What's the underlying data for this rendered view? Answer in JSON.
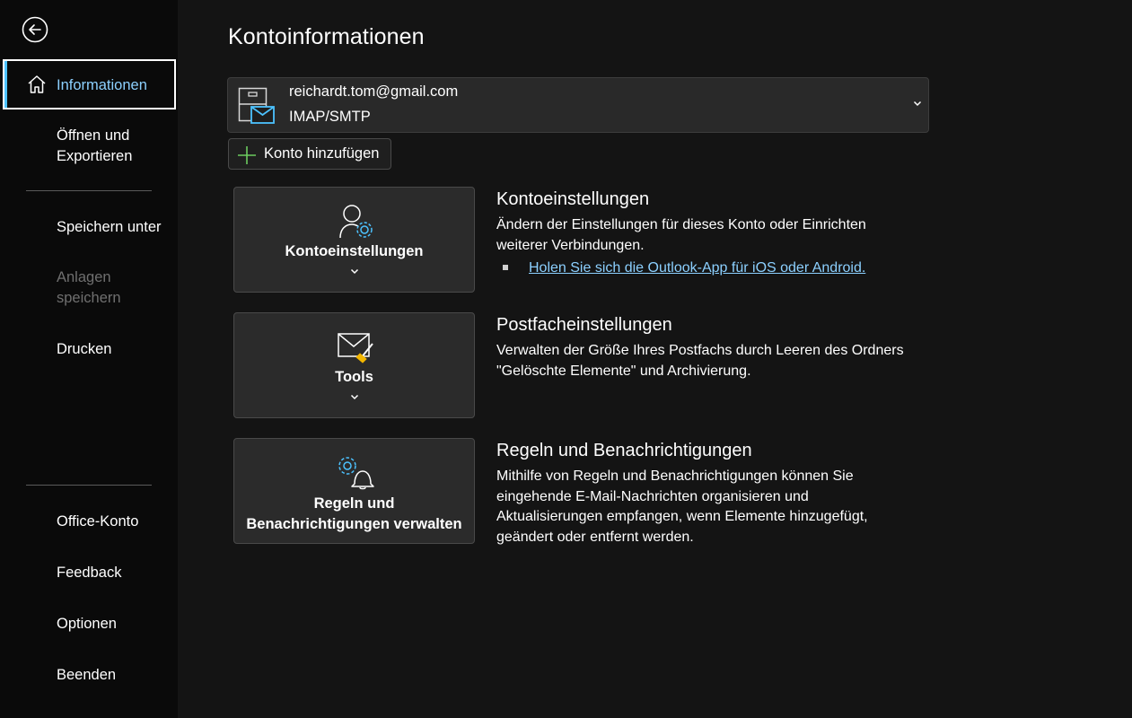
{
  "nav": {
    "items": [
      {
        "label": "Informationen"
      },
      {
        "label": "Öffnen und Exportieren"
      },
      {
        "label": "Speichern unter"
      },
      {
        "label": "Anlagen speichern"
      },
      {
        "label": "Drucken"
      },
      {
        "label": "Office-Konto"
      },
      {
        "label": "Feedback"
      },
      {
        "label": "Optionen"
      },
      {
        "label": "Beenden"
      }
    ],
    "back_icon": "back-arrow-icon",
    "accent_color": "#4cc2ff"
  },
  "page": {
    "title": "Kontoinformationen"
  },
  "account": {
    "email": "reichardt.tom@gmail.com",
    "type": "IMAP/SMTP",
    "add_label": "Konto hinzufügen"
  },
  "sections": [
    {
      "tile_label": "Kontoeinstellungen",
      "title": "Kontoeinstellungen",
      "description": "Ändern der Einstellungen für dieses Konto oder Einrichten weiterer Verbindungen.",
      "link": "Holen Sie sich die Outlook-App für iOS oder Android."
    },
    {
      "tile_label": "Tools",
      "title": "Postfacheinstellungen",
      "description": "Verwalten der Größe Ihres Postfachs durch Leeren des Ordners \"Gelöschte Elemente\" und Archivierung."
    },
    {
      "tile_label": "Regeln und Benachrichtigungen verwalten",
      "title": "Regeln und Benachrichtigungen",
      "description": "Mithilfe von Regeln und Benachrichtigungen können Sie eingehende E-Mail-Nachrichten organisieren und Aktualisierungen empfangen, wenn Elemente hinzugefügt, geändert oder entfernt werden."
    }
  ]
}
